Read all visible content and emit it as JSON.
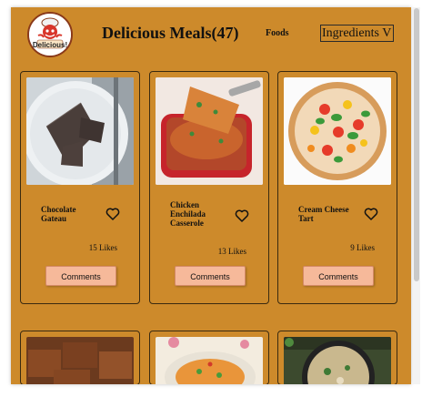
{
  "header": {
    "logo_text": "Delicious!",
    "title": "Delicious Meals(47)",
    "nav_foods": "Foods",
    "ingredients_select": "Ingredients V"
  },
  "meals": [
    {
      "name": "Chocolate Gateau",
      "likes": "15 Likes",
      "comments_label": "Comments",
      "image": "chocolate-gateau-image"
    },
    {
      "name": "Chicken Enchilada Casserole",
      "likes": "13 Likes",
      "comments_label": "Comments",
      "image": "enchilada-casserole-image"
    },
    {
      "name": "Cream Cheese Tart",
      "likes": "9 Likes",
      "comments_label": "Comments",
      "image": "cream-cheese-tart-image"
    }
  ],
  "next_row_images": [
    "brownies-image",
    "pasta-bowl-image",
    "pan-dish-image"
  ],
  "colors": {
    "page_background": "#cd8a2b",
    "button_background": "#f6b99a",
    "card_border": "#3a2a10"
  }
}
